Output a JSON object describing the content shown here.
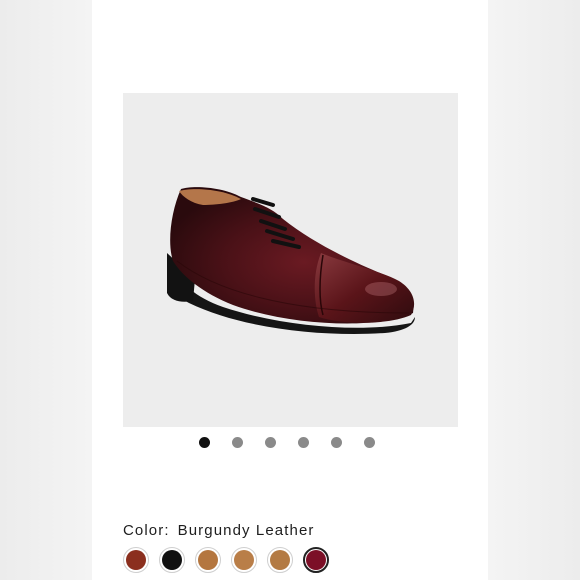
{
  "product": {
    "image_icon": "oxford-cap-toe-shoe",
    "carousel": {
      "count": 6,
      "active_index": 0
    },
    "color": {
      "label": "Color:",
      "selected_name": "Burgundy Leather",
      "swatches": [
        {
          "color": "#8b2f1e"
        },
        {
          "color": "#111111"
        },
        {
          "color": "#b4763f"
        },
        {
          "color": "#b97e48"
        },
        {
          "color": "#b37a43"
        },
        {
          "color": "#7c0f27"
        }
      ],
      "selected_index": 5
    }
  }
}
